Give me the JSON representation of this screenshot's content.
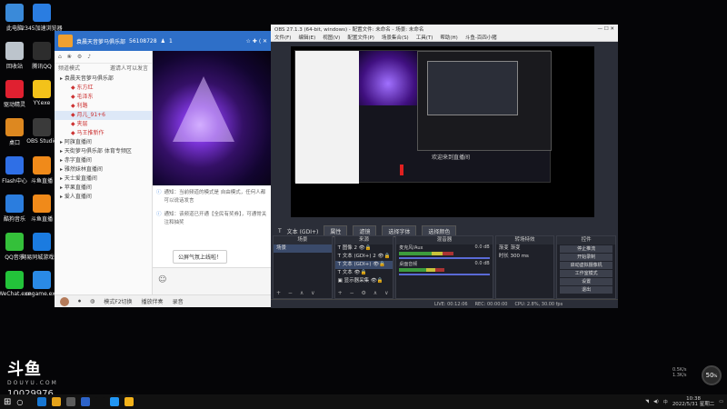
{
  "desktop_icons": [
    {
      "label": "此电脑",
      "color": "#3a8ad9"
    },
    {
      "label": "2345加速浏览器",
      "color": "#2a7de1"
    },
    {
      "label": "回收站",
      "color": "#bcc4cc"
    },
    {
      "label": "腾讯QQ",
      "color": "#2d2d2d"
    },
    {
      "label": "驱动精灵",
      "color": "#e02030"
    },
    {
      "label": "YY.exe",
      "color": "#f3c21a"
    },
    {
      "label": "桌口",
      "color": "#dd8820"
    },
    {
      "label": "OBS Studio",
      "color": "#3a3a3a"
    },
    {
      "label": "Flash中心",
      "color": "#2f6fe6"
    },
    {
      "label": "斗鱼直播",
      "color": "#f08a1a"
    },
    {
      "label": "酷狗音乐",
      "color": "#2b7dde"
    },
    {
      "label": "斗鱼直播",
      "color": "#f08a1a"
    },
    {
      "label": "QQ音乐",
      "color": "#34c03a"
    },
    {
      "label": "网易同城游戏5.0",
      "color": "#1b7be0"
    },
    {
      "label": "WeChat.exe",
      "color": "#23c33a"
    },
    {
      "label": "cngame.exe",
      "color": "#2a8ae6"
    }
  ],
  "chat": {
    "title": "袁晨天音萝马俱乐部",
    "room_no": "56108728",
    "member_count": "1",
    "toolbar": [
      "频道模式",
      "邀请人可以发言"
    ],
    "tree": [
      {
        "text": "袁晨天音萝马俱乐部",
        "type": "group"
      },
      {
        "text": "东方红",
        "type": "sub"
      },
      {
        "text": "毛泽东",
        "type": "sub"
      },
      {
        "text": "利路",
        "type": "sub"
      },
      {
        "text": "月儿_91+6",
        "type": "sub",
        "selected": true
      },
      {
        "text": "夹层",
        "type": "sub"
      },
      {
        "text": "马王推新作",
        "type": "sub"
      },
      {
        "text": "阿旗直播间",
        "type": "group"
      },
      {
        "text": "天街萝马俱乐部 体育专频区",
        "type": "group"
      },
      {
        "text": "赤字直播间",
        "type": "group"
      },
      {
        "text": "雅然妹林直播间",
        "type": "group"
      },
      {
        "text": "天士爱直播间",
        "type": "group"
      },
      {
        "text": "苹果直播间",
        "type": "group"
      },
      {
        "text": "爱人直播间",
        "type": "group"
      }
    ],
    "messages": [
      {
        "text": "通知：当前频道的模式是 自由模式，任何人都可以说话发言"
      },
      {
        "text": "通知：该频道已开通【全民有奖券】，可通常关注和抽奖"
      }
    ],
    "popup": "公屏气氛上线啦！",
    "footer": [
      "模式F2切换",
      "播放伴奏",
      "录音"
    ]
  },
  "obs": {
    "title": "OBS 27.1.3 (64-bit, windows) - 配置文件: 未命名 - 场景: 未命名",
    "menu": [
      "文件(F)",
      "编辑(E)",
      "视图(V)",
      "配置文件(P)",
      "场景集合(S)",
      "工具(T)",
      "帮助(H)",
      "斗鱼-百四小猪"
    ],
    "preview_caption": "欢迎来到直播间",
    "scene_label": "文本 (GDI+)",
    "scene_buttons": [
      "属性",
      "滤镜",
      "选择字体",
      "选择颜色"
    ],
    "docks": {
      "scenes": {
        "title": "场景",
        "items": [
          "场景"
        ]
      },
      "sources": {
        "title": "来源",
        "items": [
          "图像 2",
          "文本 (GDI+) 2",
          "文本 (GDI+)",
          "文本",
          "显示器采集"
        ]
      },
      "mixer": {
        "title": "混音器",
        "tracks": [
          {
            "name": "麦克风/Aux",
            "db": "0.0 dB",
            "level": 0.6
          },
          {
            "name": "桌面音频",
            "db": "0.0 dB",
            "level": 0.5
          }
        ]
      },
      "transitions": {
        "title": "转场特效",
        "fields": [
          {
            "label": "渐变",
            "value": "渐变"
          },
          {
            "label": "时长",
            "value": "300 ms"
          }
        ]
      },
      "controls": {
        "title": "控件",
        "buttons": [
          "停止推流",
          "开始录制",
          "启动虚拟摄像机",
          "工作室模式",
          "设置",
          "退出"
        ]
      }
    },
    "status": [
      "LIVE: 00:12:06",
      "REC: 00:00:00",
      "CPU: 2.8%, 30.00 fps"
    ]
  },
  "logo": {
    "text": "斗鱼",
    "sub": "DOUYU.COM"
  },
  "room_id": "10029976",
  "taskbar": {
    "items": [
      "#1877d2",
      "#e4a21a",
      "#5b5b5b",
      "#2d63c8",
      "#111",
      "#2196f3",
      "#f2b21a"
    ],
    "time": "10:38",
    "date": "2022/5/31 星期二"
  },
  "speed_widget": {
    "value": "50",
    "unit": "%",
    "net_up": "0.5K/s",
    "net_down": "1.3K/s"
  }
}
